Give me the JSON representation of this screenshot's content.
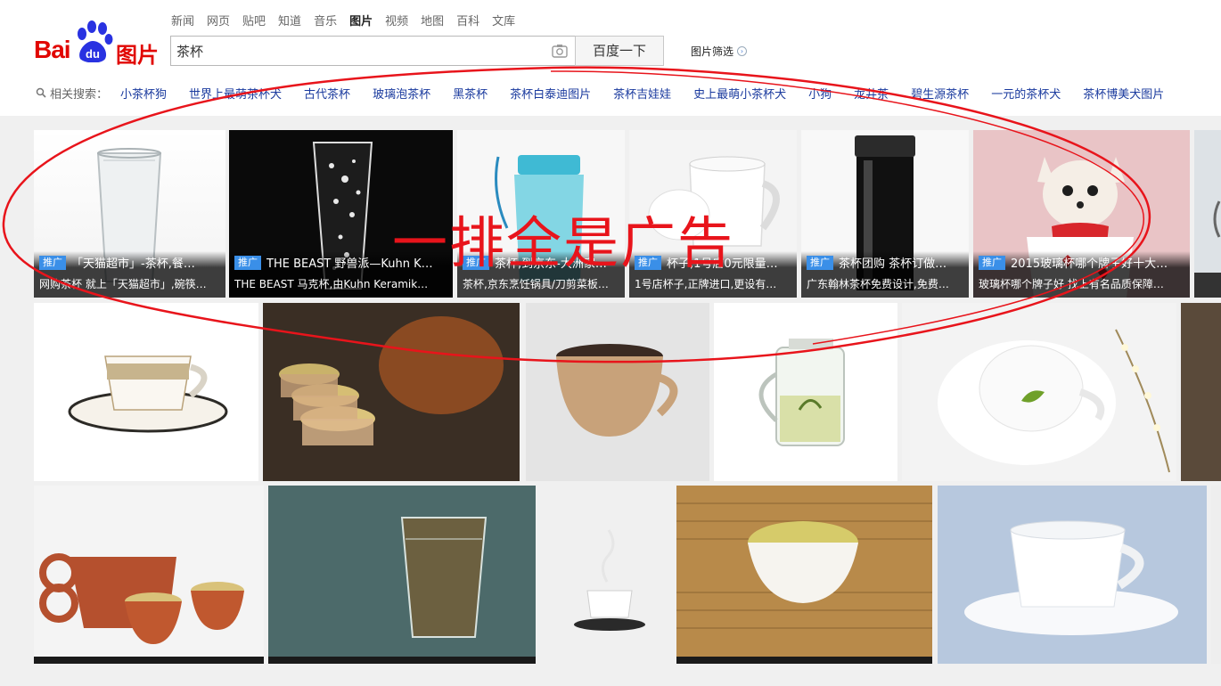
{
  "logo": {
    "bai": "Bai",
    "du": "du",
    "pic": "图片"
  },
  "nav": [
    "新闻",
    "网页",
    "贴吧",
    "知道",
    "音乐",
    "图片",
    "视频",
    "地图",
    "百科",
    "文库"
  ],
  "search": {
    "value": "茶杯",
    "button": "百度一下",
    "filter": "图片筛选"
  },
  "related": {
    "label": "相关搜索：",
    "items": [
      "小茶杯狗",
      "世界上最萌茶杯犬",
      "古代茶杯",
      "玻璃泡茶杯",
      "黑茶杯",
      "茶杯白泰迪图片",
      "茶杯吉娃娃",
      "史上最萌小茶杯犬",
      "小狗",
      "龙井茶",
      "碧生源茶杯",
      "一元的茶杯犬",
      "茶杯博美犬图片"
    ]
  },
  "ads": [
    {
      "badge": "推广",
      "title": "「天猫超市」-茶杯,餐…",
      "desc": "网购茶杯 就上「天猫超市」,碗筷…"
    },
    {
      "badge": "推广",
      "title": "THE BEAST 野兽派—Kuhn K…",
      "desc": "THE BEAST 马克杯,由Kuhn Keramik…"
    },
    {
      "badge": "推广",
      "title": "茶杯,到京东-大洲家…",
      "desc": "茶杯,京东烹饪锅具/刀剪菜板…"
    },
    {
      "badge": "推广",
      "title": "杯子,1号店0元限量…",
      "desc": "1号店杯子,正牌进口,更设有…"
    },
    {
      "badge": "推广",
      "title": "茶杯团购 茶杯订做…",
      "desc": "广东翰林茶杯免费设计,免费…"
    },
    {
      "badge": "推广",
      "title": "2015玻璃杯哪个牌子好十大…",
      "desc": "玻璃杯哪个牌子好 找上有名品质保障…"
    }
  ],
  "annotation": "一排全是广告",
  "colors": {
    "brand_red": "#e10602",
    "link_blue": "#1a3a9e",
    "ad_badge": "#3a8fe8",
    "annotation_red": "#e8141b"
  },
  "icons": [
    "baidu-paw-icon",
    "camera-icon",
    "search-icon",
    "chevron-right-icon"
  ]
}
